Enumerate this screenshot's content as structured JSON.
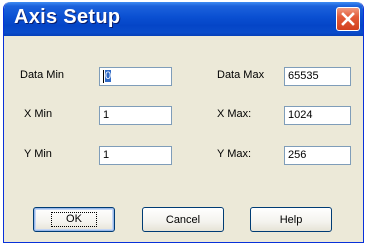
{
  "window": {
    "title": "Axis Setup"
  },
  "fields": {
    "data_min": {
      "label": "Data Min",
      "value": "0"
    },
    "data_max": {
      "label": "Data Max",
      "value": "65535"
    },
    "x_min": {
      "label": "X Min",
      "value": "1"
    },
    "x_max": {
      "label": "X Max:",
      "value": "1024"
    },
    "y_min": {
      "label": "Y Min",
      "value": "1"
    },
    "y_max": {
      "label": "Y Max:",
      "value": "256"
    }
  },
  "buttons": {
    "ok": "OK",
    "cancel": "Cancel",
    "help": "Help"
  },
  "colors": {
    "titlebar": "#0a4fd1",
    "dialog_bg": "#ece9d8",
    "close": "#d2401f",
    "selection": "#316ac5"
  },
  "icons": {
    "close": "close-icon"
  }
}
